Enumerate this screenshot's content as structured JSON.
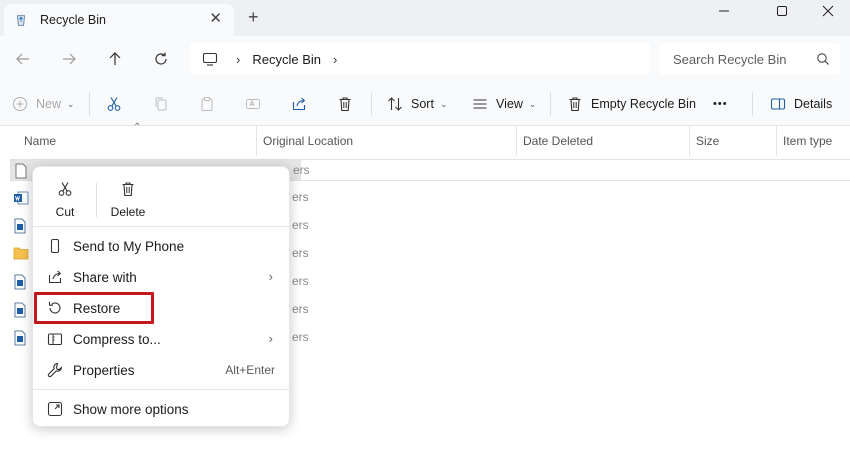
{
  "window": {
    "tab_title": "Recycle Bin",
    "tab_close": "✕",
    "new_tab": "+"
  },
  "nav": {
    "breadcrumb": "Recycle Bin",
    "search_placeholder": "Search Recycle Bin"
  },
  "toolbar": {
    "new_label": "New",
    "sort_label": "Sort",
    "view_label": "View",
    "empty_label": "Empty Recycle Bin",
    "more_label": "•••",
    "details_label": "Details"
  },
  "columns": [
    "Name",
    "Original Location",
    "Date Deleted",
    "Size",
    "Item type"
  ],
  "files": [
    {
      "icon": "blank-file-icon",
      "tail": "ers"
    },
    {
      "icon": "word-file-icon",
      "tail": "ers"
    },
    {
      "icon": "document-file-icon",
      "tail": "ers"
    },
    {
      "icon": "folder-icon",
      "tail": "ers"
    },
    {
      "icon": "document-file-icon",
      "tail": "ers"
    },
    {
      "icon": "document-file-icon",
      "tail": "ers"
    },
    {
      "icon": "document-file-icon",
      "tail": "ers"
    }
  ],
  "context_menu": {
    "cut": "Cut",
    "delete": "Delete",
    "send_to_phone": "Send to My Phone",
    "share_with": "Share with",
    "restore": "Restore",
    "compress": "Compress to...",
    "properties": "Properties",
    "properties_shortcut": "Alt+Enter",
    "show_more": "Show more options"
  },
  "colors": {
    "highlight": "#c4161c",
    "accent": "#0067c0"
  }
}
